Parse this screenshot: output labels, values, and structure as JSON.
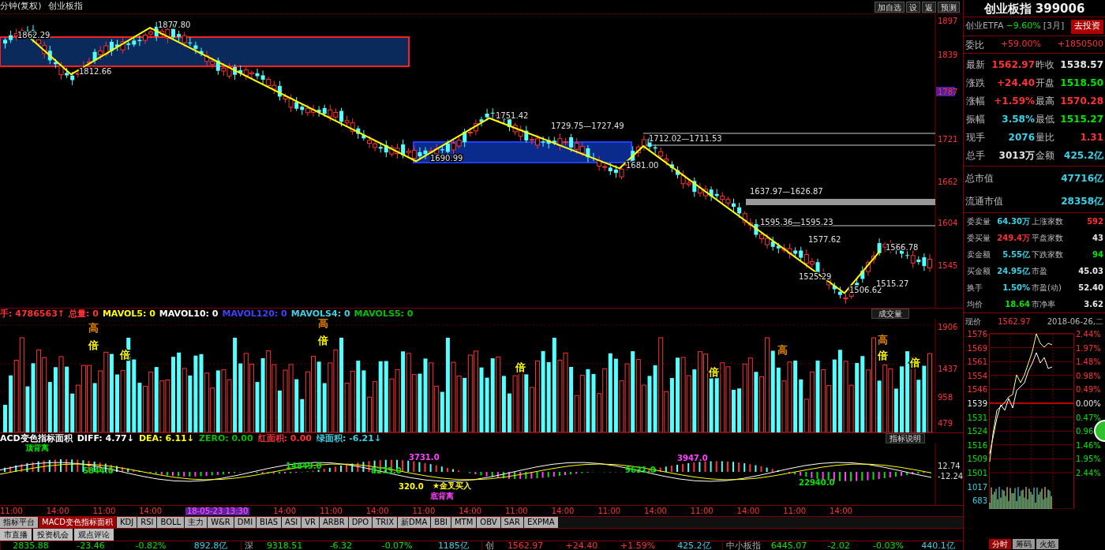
{
  "header": {
    "period": "分钟(复权)",
    "symbol": "创业板指",
    "buttons": [
      "加自选",
      "设",
      "返",
      "预测"
    ]
  },
  "main_chart": {
    "price_axis": [
      {
        "label": "1897",
        "highlighted": false
      },
      {
        "label": "1839",
        "highlighted": false
      },
      {
        "label": "1787",
        "highlighted": true
      },
      {
        "label": "1721",
        "highlighted": false
      },
      {
        "label": "1662",
        "highlighted": false
      },
      {
        "label": "1604",
        "highlighted": false
      },
      {
        "label": "1545",
        "highlighted": false
      }
    ],
    "annotations": [
      "1862.29",
      "1812.66",
      "1877.80",
      "1751.42",
      "1729.75—1727.49",
      "1690.99",
      "1681.00",
      "1712.02—1711.53",
      "1637.97—1626.87",
      "1595.36—1595.23",
      "1577.62",
      "1525.29",
      "1506.62",
      "1566.78",
      "1515.27"
    ]
  },
  "volume": {
    "stats": [
      {
        "text": "手: 4786563↑",
        "color": "#ff3232"
      },
      {
        "text": "总量: 0",
        "color": "#ff3232"
      },
      {
        "text": "MAVOL5: 0",
        "color": "#ffff00"
      },
      {
        "text": "MAVOL10: 0",
        "color": "#ffffff"
      },
      {
        "text": "MAVOL120: 0",
        "color": "#4040ff"
      },
      {
        "text": "MAVOLS4: 0",
        "color": "#3ad1e6"
      },
      {
        "text": "MAVOLS5: 0",
        "color": "#00c000"
      }
    ],
    "selector": "成交量",
    "axis": [
      "1906",
      "1437",
      "958",
      "479"
    ],
    "markers": [
      {
        "text": "高",
        "color": "#e08000"
      },
      {
        "text": "倍",
        "color": "#ffff00"
      },
      {
        "text": "倍",
        "color": "#ffff00"
      },
      {
        "text": "高",
        "color": "#e08000"
      },
      {
        "text": "倍",
        "color": "#ffff00"
      },
      {
        "text": "倍",
        "color": "#ffff00"
      },
      {
        "text": "倍",
        "color": "#ffff00"
      },
      {
        "text": "高",
        "color": "#e08000"
      },
      {
        "text": "高",
        "color": "#e08000"
      },
      {
        "text": "倍",
        "color": "#ffff00"
      },
      {
        "text": "倍",
        "color": "#ffff00"
      }
    ]
  },
  "macd": {
    "stats": [
      {
        "text": "ACD变色指标面积",
        "color": "#ffffff"
      },
      {
        "text": "DIFF: 4.77↓",
        "color": "#ffffff"
      },
      {
        "text": "DEA: 6.11↓",
        "color": "#ffff00"
      },
      {
        "text": "ZERO: 0.00",
        "color": "#00c000"
      },
      {
        "text": "红面积: 0.00",
        "color": "#ff3232"
      },
      {
        "text": "绿面积: -6.21↓",
        "color": "#3ad1e6"
      }
    ],
    "help": "指标说明",
    "axis": [
      "12.74",
      "-12.24"
    ],
    "labels": [
      {
        "text": "顶背离",
        "color": "#00e600"
      },
      {
        "text": "5844.0",
        "color": "#00e600"
      },
      {
        "text": "14849.0",
        "color": "#00e600"
      },
      {
        "text": "8273.0",
        "color": "#00e600"
      },
      {
        "text": "3731.0",
        "color": "#ff40ff"
      },
      {
        "text": "320.0",
        "color": "#ffff00"
      },
      {
        "text": "★金叉买入",
        "color": "#ffff00"
      },
      {
        "text": "底背离",
        "color": "#ff40ff"
      },
      {
        "text": "9631.0",
        "color": "#00e600"
      },
      {
        "text": "3947.0",
        "color": "#ff40ff"
      },
      {
        "text": "22940.0",
        "color": "#00e600"
      }
    ]
  },
  "time_axis": [
    {
      "label": "11:00",
      "highlighted": false
    },
    {
      "label": "14:00",
      "highlighted": false
    },
    {
      "label": "11:00",
      "highlighted": false
    },
    {
      "label": "14:00",
      "highlighted": false
    },
    {
      "label": "18-05-23 13:30",
      "highlighted": true
    },
    {
      "label": "14:00",
      "highlighted": false
    },
    {
      "label": "11:00",
      "highlighted": false
    },
    {
      "label": "14:00",
      "highlighted": false
    },
    {
      "label": "11:00",
      "highlighted": false
    },
    {
      "label": "14:00",
      "highlighted": false
    },
    {
      "label": "11:00",
      "highlighted": false
    },
    {
      "label": "14:00",
      "highlighted": false
    },
    {
      "label": "11:00",
      "highlighted": false
    },
    {
      "label": "14:00",
      "highlighted": false
    },
    {
      "label": "11:00",
      "highlighted": false
    },
    {
      "label": "14:00",
      "highlighted": false
    },
    {
      "label": "11:00",
      "highlighted": false
    },
    {
      "label": "14:00",
      "highlighted": false
    }
  ],
  "indicator_tabs": [
    {
      "label": "指标平台",
      "selected": false
    },
    {
      "label": "MACD变色指标面积",
      "selected": true
    },
    {
      "label": "KDJ",
      "selected": false
    },
    {
      "label": "RSI",
      "selected": false
    },
    {
      "label": "BOLL",
      "selected": false
    },
    {
      "label": "主力",
      "selected": false
    },
    {
      "label": "W&R",
      "selected": false
    },
    {
      "label": "DMI",
      "selected": false
    },
    {
      "label": "BIAS",
      "selected": false
    },
    {
      "label": "ASI",
      "selected": false
    },
    {
      "label": "VR",
      "selected": false
    },
    {
      "label": "ARBR",
      "selected": false
    },
    {
      "label": "DPO",
      "selected": false
    },
    {
      "label": "TRIX",
      "selected": false
    },
    {
      "label": "新DMA",
      "selected": false
    },
    {
      "label": "BBI",
      "selected": false
    },
    {
      "label": "MTM",
      "selected": false
    },
    {
      "label": "OBV",
      "selected": false
    },
    {
      "label": "SAR",
      "selected": false
    },
    {
      "label": "EXPMA",
      "selected": false
    }
  ],
  "info_tabs": [
    "市直播",
    "投资机会",
    "观点评论"
  ],
  "status_bar": [
    {
      "values": [
        {
          "text": "2835.88",
          "kind": "down"
        },
        {
          "text": "-23.46",
          "kind": "down"
        },
        {
          "text": "-0.82%",
          "kind": "down"
        },
        {
          "text": "892.8亿",
          "kind": "amount"
        }
      ]
    },
    {
      "name": "深",
      "values": [
        {
          "text": "9318.51",
          "kind": "down"
        },
        {
          "text": "-6.32",
          "kind": "down"
        },
        {
          "text": "-0.07%",
          "kind": "down"
        },
        {
          "text": "1185亿",
          "kind": "amount"
        }
      ]
    },
    {
      "name": "创",
      "values": [
        {
          "text": "1562.97",
          "kind": "up"
        },
        {
          "text": "+24.40",
          "kind": "up"
        },
        {
          "text": "+1.59%",
          "kind": "up"
        },
        {
          "text": "425.2亿",
          "kind": "amount"
        }
      ]
    },
    {
      "name": "中小板指",
      "values": [
        {
          "text": "6445.07",
          "kind": "down"
        },
        {
          "text": "-2.02",
          "kind": "down"
        },
        {
          "text": "-0.03%",
          "kind": "down"
        },
        {
          "text": "440.1亿",
          "kind": "amount"
        }
      ]
    }
  ],
  "quote": {
    "title": "创业板指 399006",
    "etf": {
      "name": "创业ETFA",
      "change": "−9.60%",
      "period": "[3月]",
      "button": "去投资"
    },
    "ratio": {
      "label": "委比",
      "pct": "+59.00%",
      "amount": "+1850500"
    },
    "rows": [
      {
        "label": "最新",
        "value": "1562.97",
        "kind": "up"
      },
      {
        "label": "昨收",
        "value": "1538.57",
        "kind": "flat"
      },
      {
        "label": "涨跌",
        "value": "+24.40",
        "kind": "up"
      },
      {
        "label": "开盘",
        "value": "1518.50",
        "kind": "down"
      },
      {
        "label": "涨幅",
        "value": "+1.59%",
        "kind": "up"
      },
      {
        "label": "最高",
        "value": "1570.28",
        "kind": "up"
      },
      {
        "label": "振幅",
        "value": "3.58%",
        "kind": "amount"
      },
      {
        "label": "最低",
        "value": "1515.27",
        "kind": "down"
      },
      {
        "label": "现手",
        "value": "2076",
        "kind": "amount"
      },
      {
        "label": "量比",
        "value": "1.31",
        "kind": "up"
      },
      {
        "label": "总手",
        "value": "3013万",
        "kind": "flat"
      },
      {
        "label": "金额",
        "value": "425.2亿",
        "kind": "amount"
      }
    ],
    "market": [
      {
        "label": "总市值",
        "value": "47716亿"
      },
      {
        "label": "流通市值",
        "value": "28358亿"
      }
    ],
    "orders": [
      {
        "label": "委卖量",
        "value": "64.30万",
        "kind": "amount"
      },
      {
        "label": "上涨家数",
        "value": "592",
        "kind": "up"
      },
      {
        "label": "委买量",
        "value": "249.4万",
        "kind": "up"
      },
      {
        "label": "平盘家数",
        "value": "43",
        "kind": "flat"
      },
      {
        "label": "卖金额",
        "value": "5.55亿",
        "kind": "amount"
      },
      {
        "label": "下跌家数",
        "value": "94",
        "kind": "down"
      },
      {
        "label": "买金额",
        "value": "24.95亿",
        "kind": "amount"
      },
      {
        "label": "市盈",
        "value": "45.03",
        "kind": "flat"
      },
      {
        "label": "换手",
        "value": "1.50%",
        "kind": "amount"
      },
      {
        "label": "市盈(动)",
        "value": "52.40",
        "kind": "flat"
      },
      {
        "label": "均价",
        "value": "18.64",
        "kind": "down"
      },
      {
        "label": "市净率",
        "value": "3.62",
        "kind": "flat"
      }
    ]
  },
  "intraday": {
    "label": "现价",
    "price": "1562.97",
    "date": "2018-06-26,二",
    "ticks": [
      {
        "price": "1576",
        "pct": "2.44%",
        "kind": "up"
      },
      {
        "price": "1569",
        "pct": "1.97%",
        "kind": "up"
      },
      {
        "price": "1561",
        "pct": "1.48%",
        "kind": "up"
      },
      {
        "price": "1554",
        "pct": "0.98%",
        "kind": "up"
      },
      {
        "price": "1546",
        "pct": "0.49%",
        "kind": "up"
      },
      {
        "price": "1539",
        "pct": "0.00%",
        "kind": "flat"
      },
      {
        "price": "1531",
        "pct": "0.47%",
        "kind": "down"
      },
      {
        "price": "1524",
        "pct": "0.96",
        "kind": "down"
      },
      {
        "price": "1516",
        "pct": "1.46%",
        "kind": "down"
      },
      {
        "price": "1509",
        "pct": "1.95%",
        "kind": "down"
      },
      {
        "price": "1501",
        "pct": "2.44%",
        "kind": "down"
      }
    ],
    "volume_axis": [
      "1017",
      "683"
    ],
    "tabs": [
      {
        "label": "分时",
        "selected": true
      },
      {
        "label": "筹码",
        "selected": false
      },
      {
        "label": "火焰",
        "selected": false
      }
    ]
  }
}
